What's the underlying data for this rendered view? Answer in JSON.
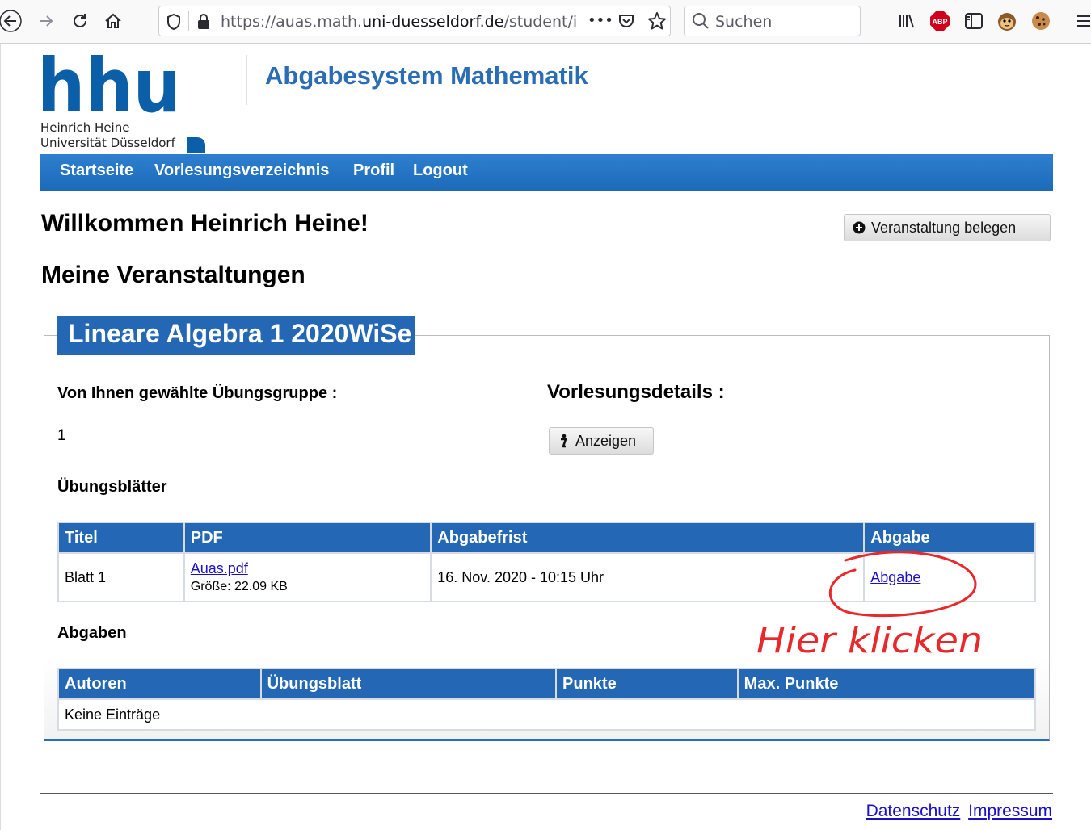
{
  "browser": {
    "url_prefix": "https://auas.math.",
    "url_host": "uni-duesseldorf.de",
    "url_suffix": "/student/inde",
    "more_label": "•••",
    "search_placeholder": "Suchen",
    "icons": [
      "back-arrow-icon",
      "forward-arrow-icon",
      "reload-icon",
      "home-icon",
      "shield-icon",
      "lock-icon",
      "pocket-icon",
      "star-icon",
      "search-icon",
      "library-icon",
      "adblock-icon",
      "sidebar-icon",
      "extension-monkey-icon",
      "cookie-icon",
      "menu-icon"
    ],
    "adblock_label": "ABP"
  },
  "logo": {
    "wordmark": "hhu",
    "line1": "Heinrich Heine",
    "line2": "Universität Düsseldorf",
    "color": "#0a5fa8"
  },
  "header": {
    "title": "Abgabesystem Mathematik"
  },
  "nav": {
    "items": [
      "Startseite",
      "Vorlesungsverzeichnis",
      "Profil",
      "Logout"
    ]
  },
  "main": {
    "welcome": "Willkommen Heinrich Heine!",
    "enroll_button": "Veranstaltung belegen",
    "section_title": "Meine Veranstaltungen"
  },
  "course": {
    "title": "Lineare Algebra 1 2020WiSe",
    "group_label": "Von Ihnen gewählte Übungsgruppe :",
    "group_value": "1",
    "details_label": "Vorlesungsdetails :",
    "details_button": "Anzeigen",
    "sheets_label": "Übungsblätter",
    "sheets_table": {
      "headers": [
        "Titel",
        "PDF",
        "Abgabefrist",
        "Abgabe"
      ],
      "rows": [
        {
          "title": "Blatt 1",
          "pdf_link": "Auas.pdf",
          "pdf_size": "Größe: 22.09 KB",
          "deadline": "16. Nov. 2020 - 10:15 Uhr",
          "submit_link": "Abgabe"
        }
      ]
    },
    "submissions_label": "Abgaben",
    "submissions_table": {
      "headers": [
        "Autoren",
        "Übungsblatt",
        "Punkte",
        "Max. Punkte"
      ],
      "empty": "Keine Einträge"
    }
  },
  "annotation": {
    "text": "Hier klicken",
    "color": "#e8282b"
  },
  "footer": {
    "links": [
      "Datenschutz",
      "Impressum"
    ]
  },
  "colors": {
    "primary": "#2367b5",
    "link": "#1a0dcc"
  }
}
